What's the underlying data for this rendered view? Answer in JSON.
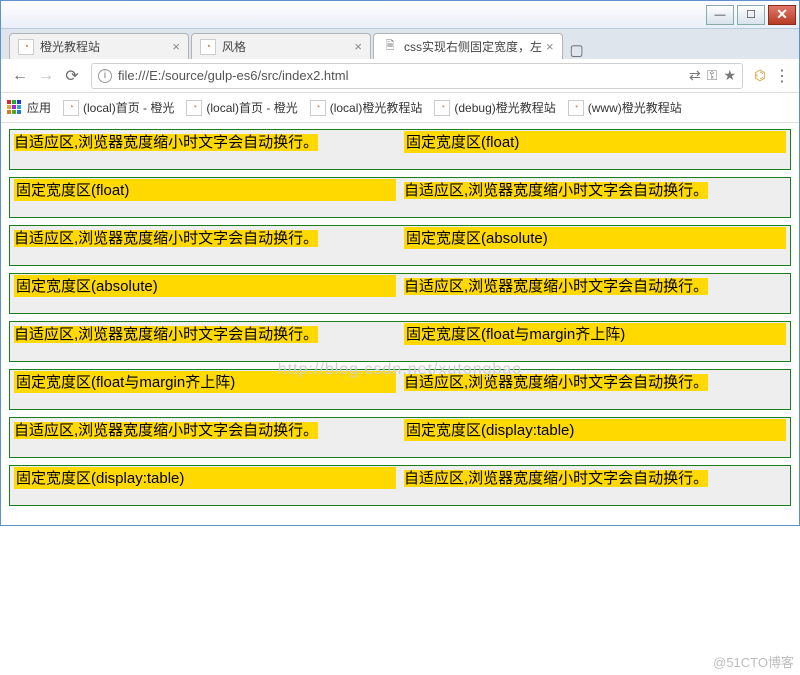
{
  "window": {
    "min": "—",
    "max": "☐",
    "close": "✕"
  },
  "tabs": [
    {
      "title": "橙光教程站",
      "active": false,
      "fav": "cg"
    },
    {
      "title": "风格",
      "active": false,
      "fav": "cg"
    },
    {
      "title": "css实现右侧固定宽度，左",
      "active": true,
      "fav": "file"
    }
  ],
  "nav": {
    "back": "←",
    "forward": "→",
    "reload": "⟳"
  },
  "address": {
    "info": "i",
    "url": "file:///E:/source/gulp-es6/src/index2.html",
    "translate": "⇄",
    "pass": "⚿",
    "star": "★"
  },
  "ext": {
    "icon": "⌬"
  },
  "menu": {
    "dots": "⋮"
  },
  "bookmarks": {
    "apps_label": "应用",
    "items": [
      "(local)首页 - 橙光",
      "(local)首页 - 橙光",
      "(local)橙光教程站",
      "(debug)橙光教程站",
      "(www)橙光教程站"
    ]
  },
  "page": {
    "flexText": "自适应区,浏览器宽度缩小时文字会自动换行。",
    "rows": [
      {
        "fixedLabel": "固定宽度区(float)"
      },
      {
        "fixedLabel": "固定宽度区(float)"
      },
      {
        "fixedLabel": "固定宽度区(absolute)"
      },
      {
        "fixedLabel": "固定宽度区(absolute)"
      },
      {
        "fixedLabel": "固定宽度区(float与margin齐上阵)"
      },
      {
        "fixedLabel": "固定宽度区(float与margin齐上阵)"
      },
      {
        "fixedLabel": "固定宽度区(display:table)"
      },
      {
        "fixedLabel": "固定宽度区(display:table)"
      }
    ]
  },
  "watermark": "http://blog.csdn.net/xutongbao",
  "corner": "@51CTO博客"
}
